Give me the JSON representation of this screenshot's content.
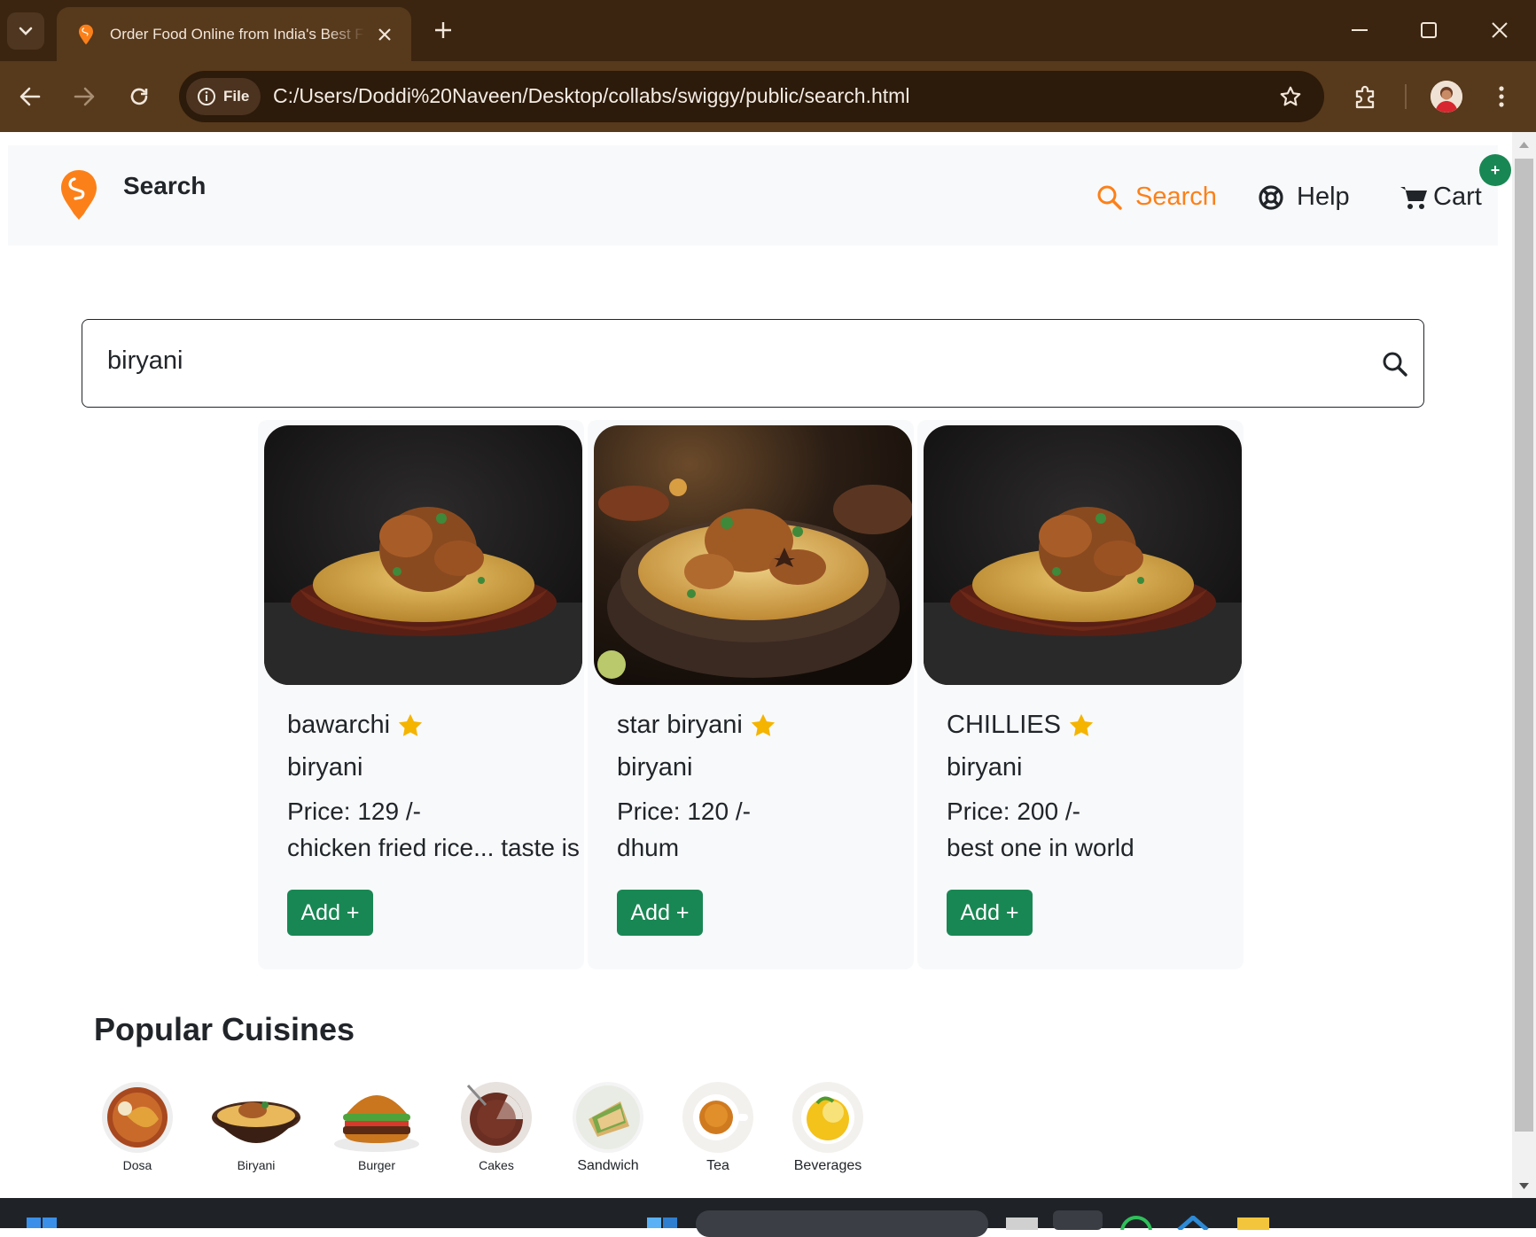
{
  "browser": {
    "tab_title": "Order Food Online from India's Best Food Delivery Service",
    "address_chip": "File",
    "url": "C:/Users/Doddi%20Naveen/Desktop/collabs/swiggy/public/search.html"
  },
  "navbar": {
    "brand": "Search",
    "links": {
      "search": "Search",
      "help": "Help",
      "cart": "Cart"
    },
    "cart_badge": "+"
  },
  "search": {
    "value": "biryani"
  },
  "results": [
    {
      "name": "bawarchi",
      "category": "biryani",
      "price": "Price: 129 /-",
      "description": "chicken fried rice... taste is s",
      "button": "Add +"
    },
    {
      "name": "star biryani",
      "category": "biryani",
      "price": "Price: 120 /-",
      "description": "dhum",
      "button": "Add +"
    },
    {
      "name": "CHILLIES",
      "category": "biryani",
      "price": "Price: 200 /-",
      "description": "best one in world",
      "button": "Add +"
    }
  ],
  "popular": {
    "title": "Popular Cuisines",
    "items": [
      {
        "label": "Dosa"
      },
      {
        "label": "Biryani"
      },
      {
        "label": "Burger"
      },
      {
        "label": "Cakes"
      },
      {
        "label": "Sandwich"
      },
      {
        "label": "Tea"
      },
      {
        "label": "Beverages"
      }
    ]
  },
  "colors": {
    "brand_orange": "#fc8019",
    "success_green": "#198754",
    "star": "#f5b400"
  }
}
